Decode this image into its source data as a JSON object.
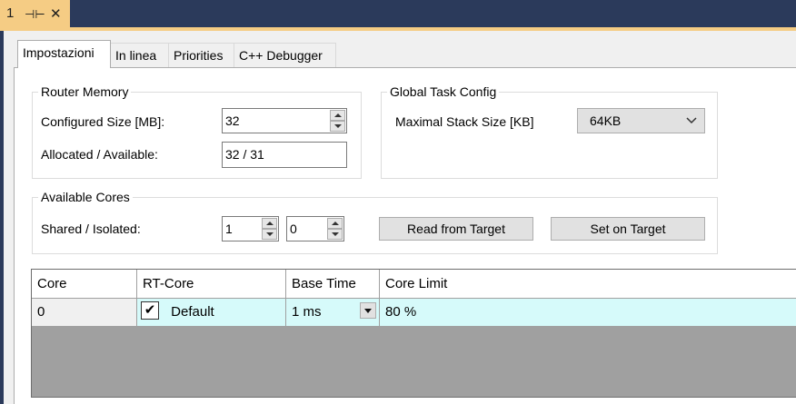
{
  "doc_tab": {
    "number": "1",
    "pin_glyph": "⊣⊢",
    "close_glyph": "✕"
  },
  "tabs": [
    {
      "label": "Impostazioni",
      "active": true
    },
    {
      "label": "In linea",
      "active": false
    },
    {
      "label": "Priorities",
      "active": false
    },
    {
      "label": "C++ Debugger",
      "active": false
    }
  ],
  "router_memory": {
    "title": "Router Memory",
    "configured_size_label": "Configured Size [MB]:",
    "configured_size_value": "32",
    "allocated_label": "Allocated / Available:",
    "allocated_value": "32 / 31"
  },
  "global_task_config": {
    "title": "Global Task Config",
    "stack_label": "Maximal Stack Size [KB]",
    "stack_value": "64KB"
  },
  "available_cores": {
    "title": "Available Cores",
    "shared_label": "Shared / Isolated:",
    "shared_value": "1",
    "isolated_value": "0",
    "read_button": "Read from Target",
    "set_button": "Set on Target"
  },
  "grid": {
    "columns": [
      "Core",
      "RT-Core",
      "Base Time",
      "Core Limit"
    ],
    "rows": [
      {
        "core": "0",
        "rt_core": "Default",
        "rt_core_checked": true,
        "base_time": "1 ms",
        "core_limit": "80 %"
      }
    ]
  },
  "colors": {
    "frame": "#2b3a5b",
    "doc_tab": "#f5cc84",
    "row_highlight": "#d6fafa",
    "grid_empty": "#a0a0a0"
  }
}
